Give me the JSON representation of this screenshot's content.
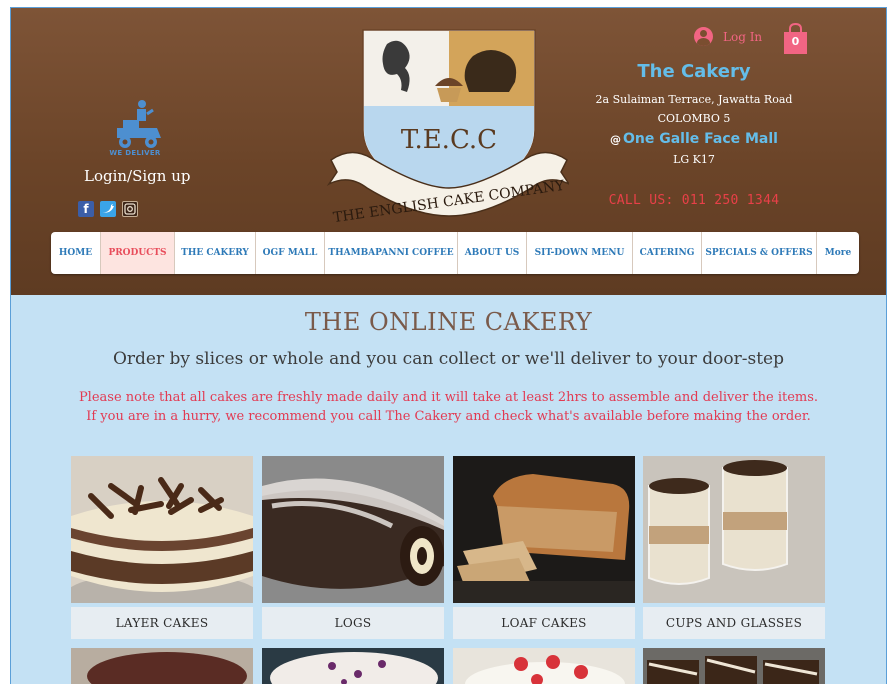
{
  "header": {
    "deliver_badge": "WE DELIVER",
    "login_signup": "Login/Sign up",
    "social": [
      "facebook-icon",
      "twitter-icon",
      "instagram-icon"
    ],
    "login_link": "Log In",
    "cart_count": "0",
    "cakery_name": "The Cakery",
    "address_line1": "2a Sulaiman Terrace, Jawatta Road",
    "address_line2": "COLOMBO 5",
    "mall_at": "@",
    "mall_name": "One Galle Face Mall",
    "mall_unit": "LG K17",
    "call": "CALL US: 011 250 1344",
    "crest": {
      "initials": "T.E.C.C",
      "banner": "THE ENGLISH CAKE COMPANY"
    }
  },
  "nav": [
    {
      "label": "HOME"
    },
    {
      "label": "PRODUCTS"
    },
    {
      "label": "THE CAKERY"
    },
    {
      "label": "OGF MALL"
    },
    {
      "label": "THAMBAPANNI COFFEE"
    },
    {
      "label": "ABOUT US"
    },
    {
      "label": "SIT-DOWN MENU"
    },
    {
      "label": "CATERING"
    },
    {
      "label": "SPECIALS & OFFERS"
    },
    {
      "label": "More"
    }
  ],
  "main": {
    "title": "THE ONLINE CAKERY",
    "subtitle": "Order by slices or whole and you can collect or we'll deliver to your door-step",
    "note_line1": "Please note that all cakes are freshly made daily and it will take at least 2hrs to assemble and deliver the items.",
    "note_line2": "If you are in a hurry, we recommend you call The Cakery and check what's available before making the order."
  },
  "categories": [
    {
      "label": "LAYER CAKES"
    },
    {
      "label": "LOGS"
    },
    {
      "label": "LOAF CAKES"
    },
    {
      "label": "CUPS AND GLASSES"
    }
  ],
  "colors": {
    "header_brown": "#6b4428",
    "page_blue": "#c4e1f4",
    "accent_pink": "#e84d5b",
    "link_blue": "#2e7ab8",
    "cakery_blue": "#64bde9",
    "call_red": "#e84048"
  }
}
